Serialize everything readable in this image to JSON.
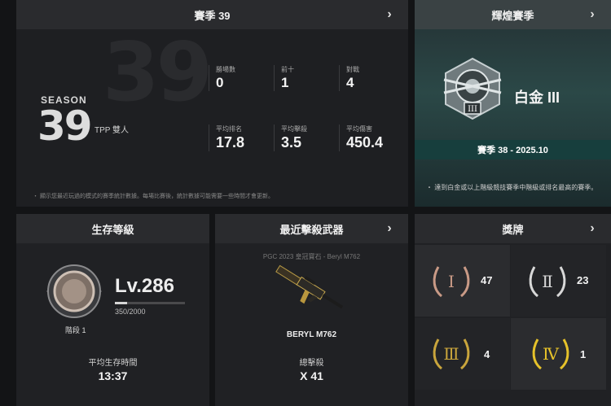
{
  "season": {
    "title": "賽季 39",
    "bg_number": "39",
    "label_word": "SEASON",
    "label_number": "39",
    "mode": "TPP 雙人",
    "stats": [
      {
        "label": "勝場數",
        "value": "0"
      },
      {
        "label": "前十",
        "value": "1"
      },
      {
        "label": "對戰",
        "value": "4"
      },
      {
        "label": "平均排名",
        "value": "17.8"
      },
      {
        "label": "平均擊殺",
        "value": "3.5"
      },
      {
        "label": "平均傷害",
        "value": "450.4"
      }
    ],
    "note": "・ 顯示您最近玩過的模式的賽季統計數據。每場比賽後，統計數據可能需要一些時間才會更新。"
  },
  "rank": {
    "title": "輝煌賽季",
    "tier_name": "白金 III",
    "band": "賽季 38 - 2025.10",
    "note": "・ 達到白金或以上階級競技賽季中階級或排名最高的賽季。"
  },
  "level": {
    "title": "生存等級",
    "level": "Lv.286",
    "xp": "350/2000",
    "xp_progress": 0.175,
    "tier": "階段 1",
    "avg_time_label": "平均生存時間",
    "avg_time_value": "13:37"
  },
  "weapon": {
    "title": "最近擊殺武器",
    "skin": "PGC 2023 皇冠寶石 - Beryl M762",
    "name": "BERYL M762",
    "kills_label": "總擊殺",
    "kills_value": "X 41"
  },
  "medals": {
    "title": "獎牌",
    "items": [
      {
        "numeral": "Ⅰ",
        "count": "47",
        "color": "#c99a86"
      },
      {
        "numeral": "Ⅱ",
        "count": "23",
        "color": "#d8d8d8"
      },
      {
        "numeral": "Ⅲ",
        "count": "4",
        "color": "#c9a53c"
      },
      {
        "numeral": "Ⅳ",
        "count": "1",
        "color": "#e6c22a"
      }
    ]
  },
  "icons": {
    "chevron": "chevron-right-icon",
    "rank_emblem": "platinum-rank-emblem-icon",
    "level_badge": "level-badge-icon",
    "weapon": "rifle-icon",
    "medal": "laurel-medal-icon"
  }
}
